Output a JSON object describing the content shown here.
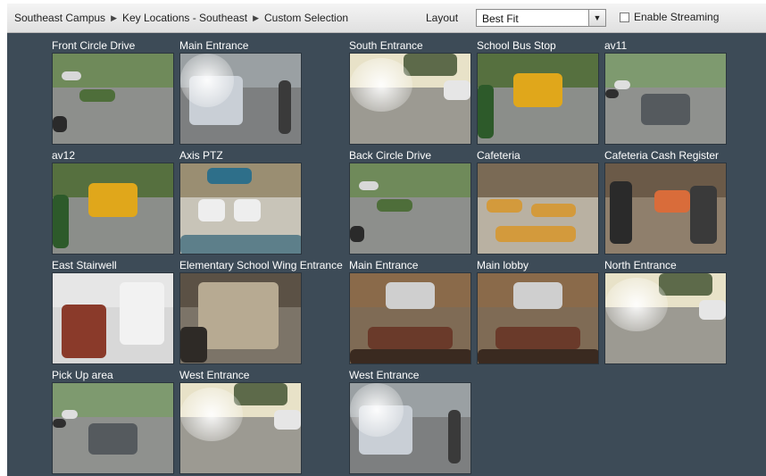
{
  "breadcrumb": [
    "Southeast Campus",
    "Key Locations - Southeast",
    "Custom Selection"
  ],
  "layout": {
    "label": "Layout",
    "value": "Best Fit"
  },
  "streaming": {
    "label": "Enable Streaming",
    "checked": false
  },
  "cameras": [
    {
      "label": "Front Circle Drive",
      "scene": "parking"
    },
    {
      "label": "Main Entrance",
      "scene": "car-glare"
    },
    {
      "label": "South Entrance",
      "scene": "sunny-lot"
    },
    {
      "label": "School Bus Stop",
      "scene": "bus"
    },
    {
      "label": "av11",
      "scene": "parking-lot"
    },
    {
      "label": "av12",
      "scene": "bus"
    },
    {
      "label": "Axis PTZ",
      "scene": "patio"
    },
    {
      "label": "Back Circle Drive",
      "scene": "parking"
    },
    {
      "label": "Cafeteria",
      "scene": "cafeteria"
    },
    {
      "label": "Cafeteria Cash Register",
      "scene": "people"
    },
    {
      "label": "East Stairwell",
      "scene": "stairs"
    },
    {
      "label": "Elementary School Wing Entrance",
      "scene": "doorway"
    },
    {
      "label": "Main Entrance",
      "scene": "lobby"
    },
    {
      "label": "Main lobby",
      "scene": "lobby"
    },
    {
      "label": "North Entrance",
      "scene": "sunny-lot"
    },
    {
      "label": "Pick Up area",
      "scene": "parking-lot"
    },
    {
      "label": "West Entrance",
      "scene": "sunny-lot"
    },
    {
      "label": "West Entrance",
      "scene": "car-glare"
    }
  ]
}
